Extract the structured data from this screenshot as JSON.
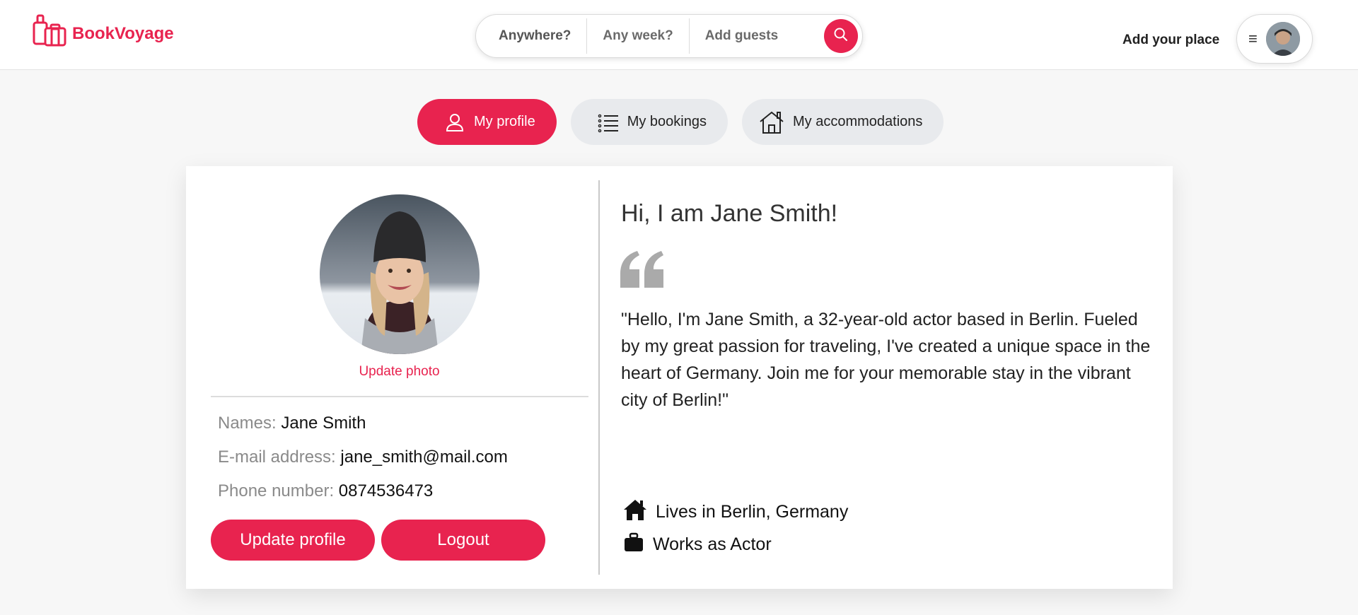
{
  "header": {
    "brand": "BookVoyage",
    "search": {
      "where": "Anywhere?",
      "when": "Any week?",
      "guests": "Add guests"
    },
    "add_place": "Add your place",
    "menu_glyph": "≡"
  },
  "tabs": [
    {
      "label": "My profile",
      "icon": "user-icon",
      "active": true
    },
    {
      "label": "My bookings",
      "icon": "list-icon",
      "active": false
    },
    {
      "label": "My accommodations",
      "icon": "house-icon",
      "active": false
    }
  ],
  "profile": {
    "update_photo": "Update photo",
    "fields": [
      {
        "label": "Names:",
        "value": "Jane Smith"
      },
      {
        "label": "E-mail address:",
        "value": "jane_smith@mail.com"
      },
      {
        "label": "Phone number:",
        "value": "0874536473"
      }
    ],
    "update_button": "Update profile",
    "logout_button": "Logout"
  },
  "about": {
    "greeting": "Hi, I am Jane Smith!",
    "bio": "\"Hello, I'm Jane Smith, a 32-year-old actor based in Berlin. Fueled by my great passion for traveling, I've created a unique space in the heart of Germany. Join me for your memorable stay in the vibrant city of Berlin!\"",
    "lives": "Lives in Berlin, Germany",
    "works": "Works as Actor"
  },
  "colors": {
    "accent": "#e8234f",
    "tab_inactive": "#e8eaed"
  }
}
